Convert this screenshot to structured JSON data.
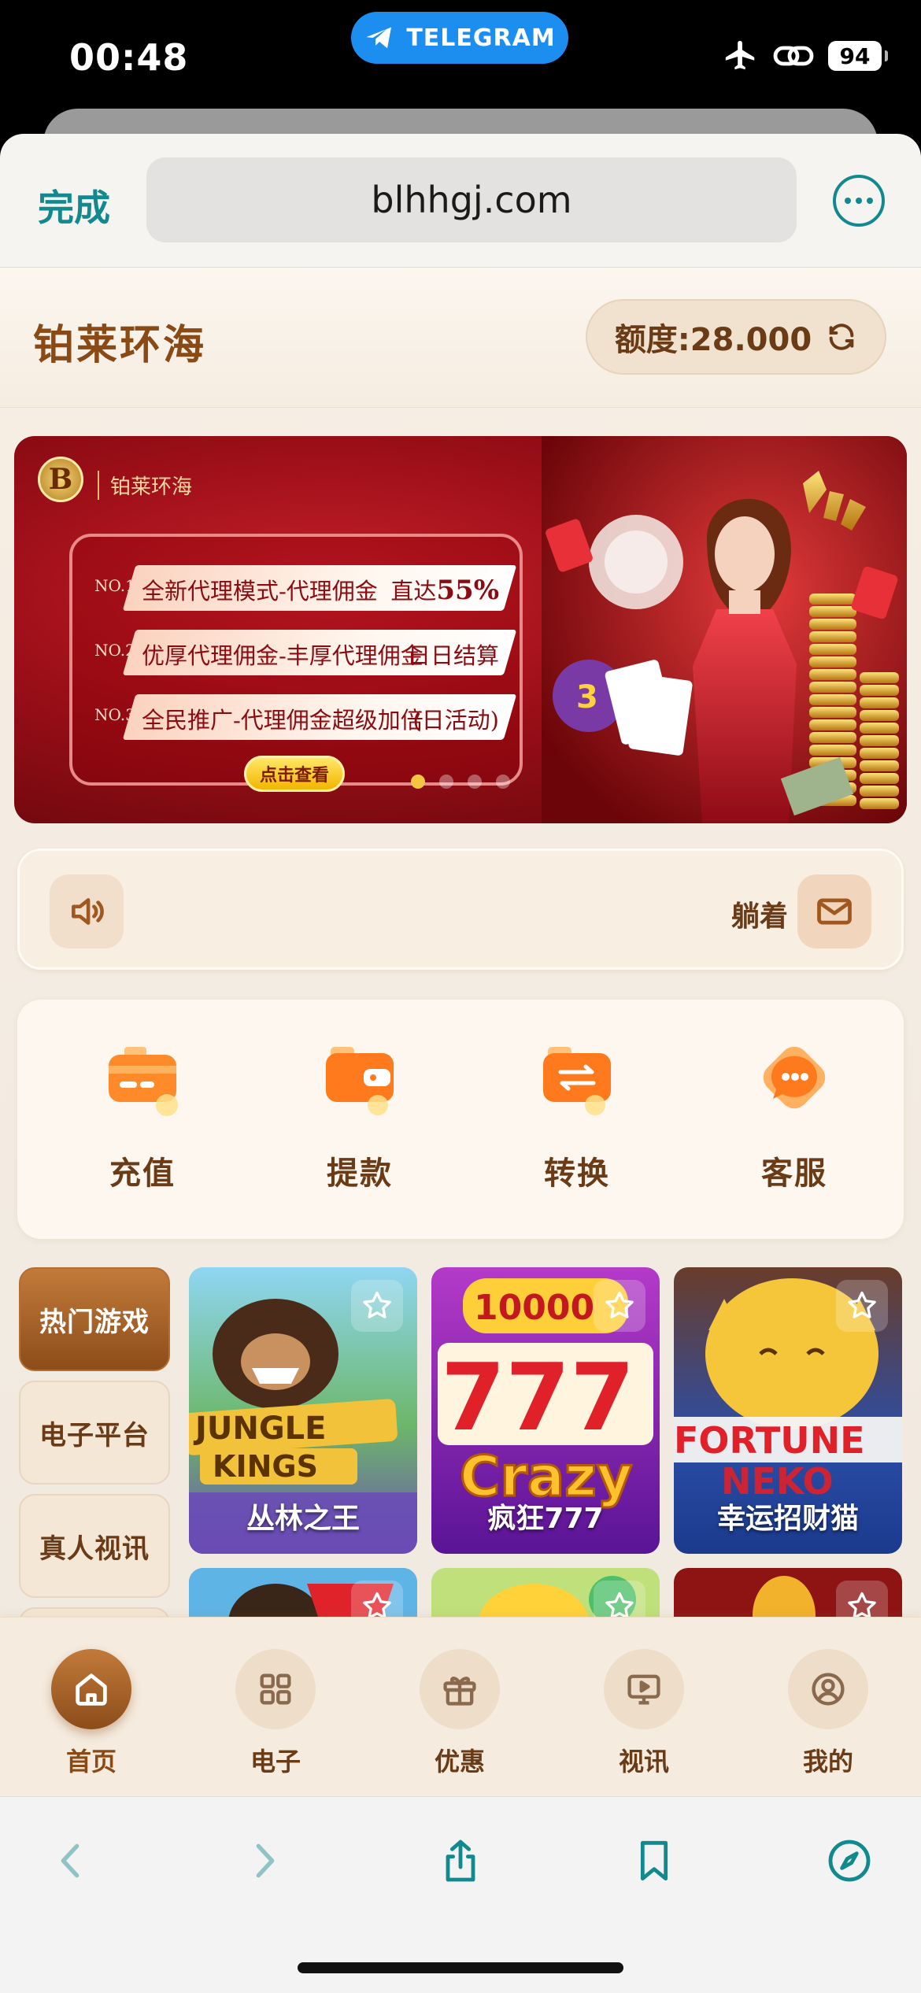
{
  "status_bar": {
    "time": "00:48",
    "telegram_label": "TELEGRAM",
    "battery": "94"
  },
  "browser": {
    "done_label": "完成",
    "url": "blhhgj.com"
  },
  "site": {
    "name": "铂莱环海",
    "balance": "额度:28.000"
  },
  "banner": {
    "logo_letter": "B",
    "brand": "铂莱环海",
    "rows": [
      {
        "no": "NO.1",
        "text": "全新代理模式-代理佣金",
        "tag_prefix": "直达",
        "tag_value": "55%"
      },
      {
        "no": "NO.2",
        "text": "优厚代理佣金-丰厚代理佣金",
        "tag_prefix": "日日结算",
        "tag_value": ""
      },
      {
        "no": "NO.3",
        "text": "全民推广-代理佣金超级加倍",
        "tag_prefix": "(日活动)",
        "tag_value": ""
      }
    ],
    "cta": "点击查看",
    "active_slide": 1,
    "slide_count": 4
  },
  "marquee": {
    "text": "躺着"
  },
  "quick_actions": [
    {
      "label": "充值",
      "icon": "recharge-card-icon"
    },
    {
      "label": "提款",
      "icon": "wallet-icon"
    },
    {
      "label": "转换",
      "icon": "transfer-icon"
    },
    {
      "label": "客服",
      "icon": "customer-service-icon"
    }
  ],
  "categories": [
    {
      "label": "热门游戏",
      "active": true
    },
    {
      "label": "电子平台",
      "active": false
    },
    {
      "label": "真人视讯",
      "active": false
    }
  ],
  "games": [
    {
      "title": "丛林之王",
      "art_text": "JUNGLE KINGS"
    },
    {
      "title": "疯狂777",
      "art_text": "777 Crazy"
    },
    {
      "title": "幸运招财猫",
      "art_text": "FORTUNE NEKO"
    }
  ],
  "tabs": [
    {
      "label": "首页",
      "icon": "home-icon",
      "active": true
    },
    {
      "label": "电子",
      "icon": "grid-icon",
      "active": false
    },
    {
      "label": "优惠",
      "icon": "gift-icon",
      "active": false
    },
    {
      "label": "视讯",
      "icon": "monitor-play-icon",
      "active": false
    },
    {
      "label": "我的",
      "icon": "user-icon",
      "active": false
    }
  ],
  "colors": {
    "accent_brown": "#8a4a16",
    "safari_teal": "#12898e"
  }
}
